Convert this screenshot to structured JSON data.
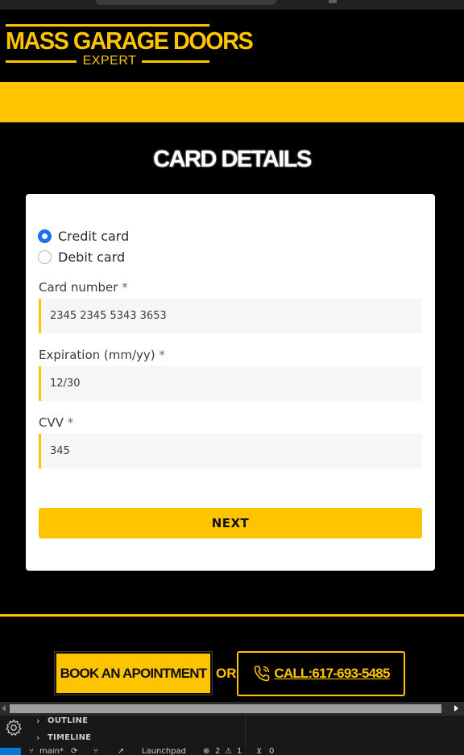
{
  "brand": {
    "title": "MASS GARAGE DOORS",
    "subtitle": "EXPERT",
    "accent_color": "#ffc400"
  },
  "page": {
    "heading": "CARD DETAILS"
  },
  "form": {
    "payment_types": [
      {
        "label": "Credit card",
        "selected": true
      },
      {
        "label": "Debit card",
        "selected": false
      }
    ],
    "card_number": {
      "label": "Card number",
      "required_mark": "*",
      "value": "2345 2345 5343 3653"
    },
    "expiration": {
      "label": "Expiration (mm/yy)",
      "required_mark": "*",
      "value": "12/30"
    },
    "cvv": {
      "label": "CVV",
      "required_mark": "*",
      "value": "345"
    },
    "next_label": "NEXT"
  },
  "footer": {
    "book_label": "BOOK AN APOINTMENT",
    "or_label": "OR",
    "call_label": "CALL:617-693-5485",
    "call_icon": "phone-icon"
  },
  "ide": {
    "sections": [
      "OUTLINE",
      "TIMELINE"
    ],
    "gear_icon": "gear-icon"
  },
  "status_bar": {
    "branch": "main*",
    "launchpad": "Launchpad",
    "errors": "2",
    "warnings": "1",
    "ports": "0"
  }
}
